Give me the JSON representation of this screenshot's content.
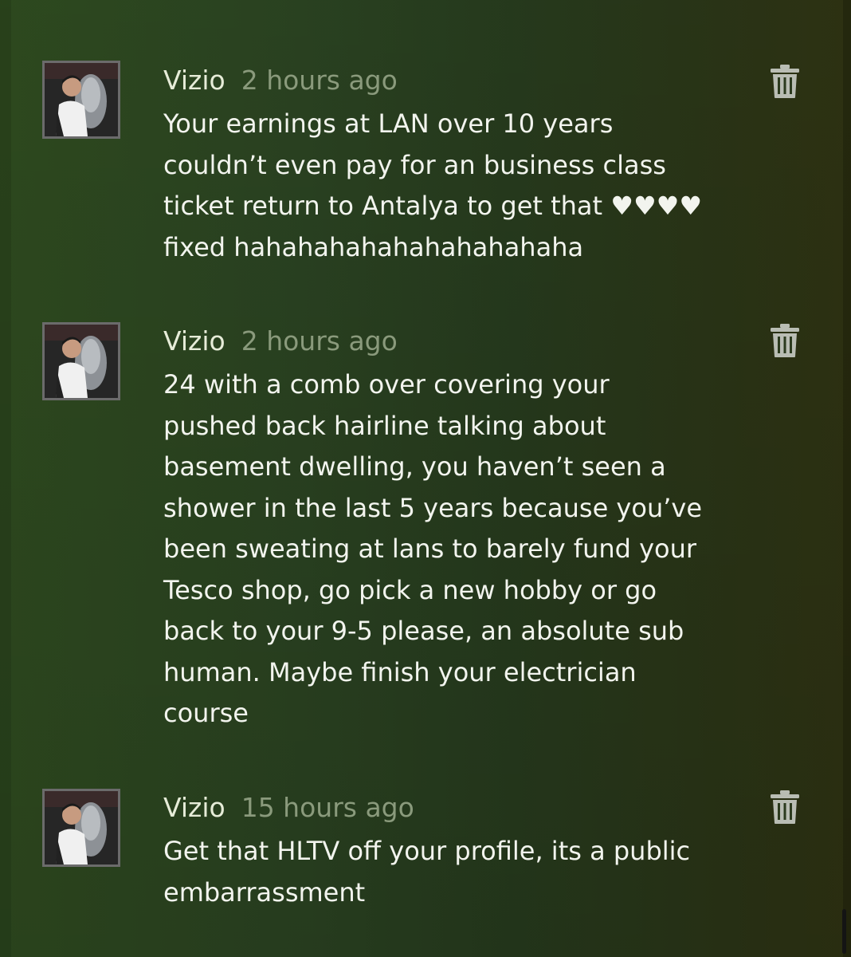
{
  "comments": [
    {
      "author": "Vizio",
      "time": "2 hours ago",
      "text": "Your earnings at LAN over 10 years\ncouldn’t even pay for an business class\nticket return to Antalya to get that ♥♥♥♥\nfixed hahahahahahahahahahaha"
    },
    {
      "author": "Vizio",
      "time": "2 hours ago",
      "text": "24 with a comb over covering your\npushed back hairline talking about\nbasement dwelling, you haven’t seen a\nshower in the last 5 years because you’ve\nbeen sweating at lans to barely fund your\nTesco shop, go pick a new hobby or go\nback to your 9-5 please, an absolute sub\nhuman. Maybe finish your electrician\ncourse"
    },
    {
      "author": "Vizio",
      "time": "15 hours ago",
      "text": "Get that HLTV off your profile, its a public\nembarrassment"
    }
  ],
  "icons": {
    "delete": "trash-icon",
    "avatar": "avatar-image"
  },
  "colors": {
    "author": "#e6ecd8",
    "timestamp": "#8a9a7c",
    "body_text": "#f2f4ee",
    "icon": "#b9bdb4"
  }
}
